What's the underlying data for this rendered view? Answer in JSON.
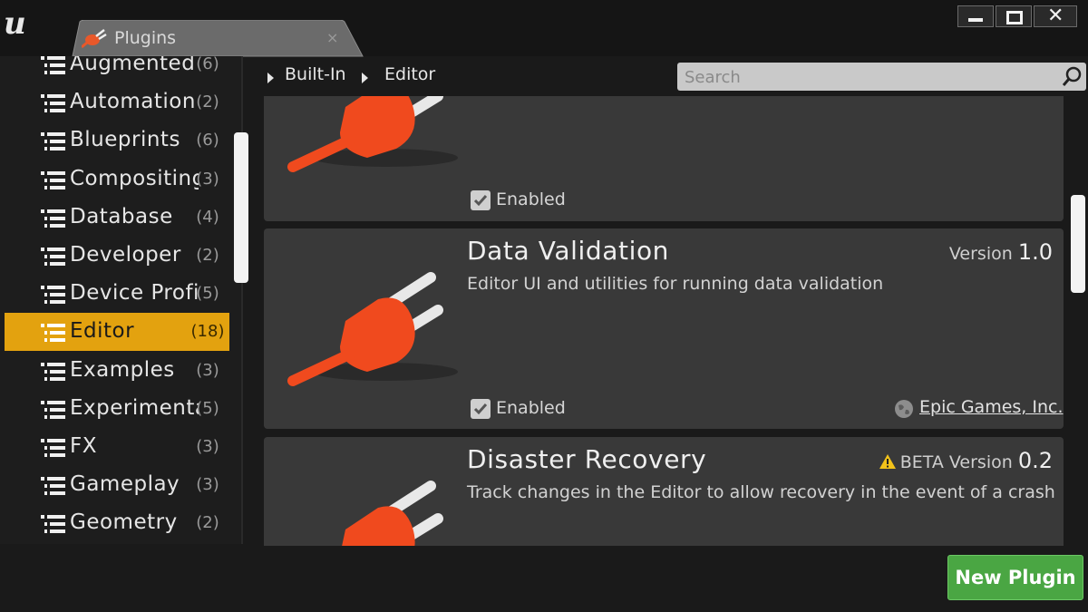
{
  "window": {
    "tab_title": "Plugins",
    "tab_close": "×",
    "close_glyph": "✕",
    "logo": "u"
  },
  "sidebar": {
    "items": [
      {
        "label": "Augmented",
        "count": "(6)"
      },
      {
        "label": "Automation",
        "count": "(2)"
      },
      {
        "label": "Blueprints",
        "count": "(6)"
      },
      {
        "label": "Compositing",
        "count": "(3)"
      },
      {
        "label": "Database",
        "count": "(4)"
      },
      {
        "label": "Developer",
        "count": "(2)"
      },
      {
        "label": "Device Profi",
        "count": "(5)"
      },
      {
        "label": "Editor",
        "count": "(18)",
        "selected": true
      },
      {
        "label": "Examples",
        "count": "(3)"
      },
      {
        "label": "Experimenta",
        "count": "(5)"
      },
      {
        "label": "FX",
        "count": "(3)"
      },
      {
        "label": "Gameplay",
        "count": "(3)"
      },
      {
        "label": "Geometry",
        "count": "(2)"
      }
    ]
  },
  "breadcrumb": [
    "Built-In",
    "Editor"
  ],
  "search": {
    "placeholder": "Search",
    "value": ""
  },
  "plugins": [
    {
      "name": "",
      "description": "",
      "enabled_label": "Enabled",
      "enabled": true
    },
    {
      "name": "Data Validation",
      "description": "Editor UI and utilities for running data validation",
      "version_label": "Version",
      "version": "1.0",
      "enabled_label": "Enabled",
      "enabled": true,
      "author": "Epic Games, Inc."
    },
    {
      "name": "Disaster Recovery",
      "description": "Track changes in the Editor to allow recovery in the event of a crash",
      "version_label": "BETA Version",
      "version": "0.2",
      "beta": true
    }
  ],
  "footer": {
    "new_plugin_label": "New Plugin"
  },
  "colors": {
    "selection": "#e3a20f",
    "plug_icon": "#f04a1e",
    "new_plugin_button": "#4aa643",
    "card_background": "#393939"
  }
}
